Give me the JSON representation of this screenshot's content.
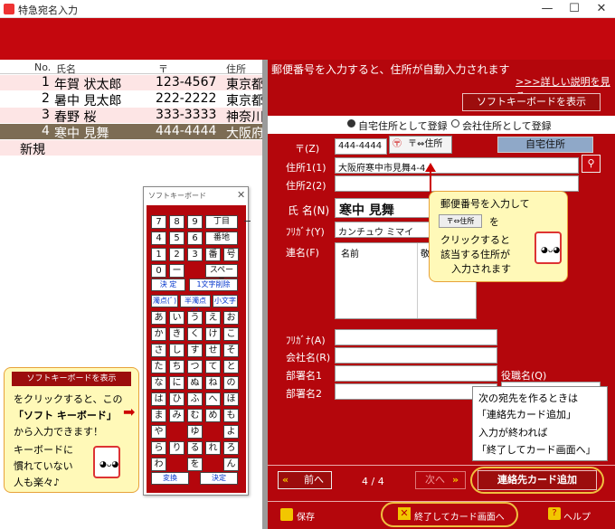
{
  "window": {
    "title": "特急宛名入力",
    "min": "—",
    "max": "☐",
    "close": "✕"
  },
  "table": {
    "headers": [
      "No.",
      "氏名",
      "〒",
      "住所"
    ],
    "rows": [
      {
        "no": "1",
        "name": "年賀 状太郎",
        "zip": "123-4567",
        "addr": "東京都"
      },
      {
        "no": "2",
        "name": "暑中 見太郎",
        "zip": "222-2222",
        "addr": "東京都"
      },
      {
        "no": "3",
        "name": "春野 桜",
        "zip": "333-3333",
        "addr": "神奈川"
      },
      {
        "no": "4",
        "name": "寒中 見舞",
        "zip": "444-4444",
        "addr": "大阪府"
      }
    ],
    "new_row": "新規"
  },
  "form": {
    "heading": "郵便番号を入力すると、住所が自動入力されます",
    "detail_link": ">>>詳しい説明を見る",
    "soft_kbd_btn": "ソフトキーボードを表示",
    "radio_home": "自宅住所として登録",
    "radio_work": "会社住所として登録",
    "zip_label": "〒(Z)",
    "zip_value": "444-4444",
    "zip_conv_btn": "〒⇔住所",
    "home_badge": "自宅住所",
    "addr1_label": "住所1(1)",
    "addr1_value": "大阪府寒中市見舞4-4",
    "addr2_label": "住所2(2)",
    "name_label": "氏 名(N)",
    "name_value": "寒中 見舞",
    "kana_label": "ﾌﾘｶﾞﾅ(Y)",
    "kana_value": "カンチュウ ミマイ",
    "joint_label": "連名(F)",
    "joint_col": "名前",
    "joint_col2": "敬",
    "furigana_label": "ﾌﾘｶﾞﾅ(A)",
    "company_label": "会社名(R)",
    "dept1_label": "部署名1",
    "dept2_label": "部署名2",
    "title_label": "役職名(Q)",
    "prev_btn": "前へ",
    "page": "4 / 4",
    "next_btn": "次へ",
    "add_btn": "連絡先カード追加",
    "save_btn": "保存",
    "finish_btn": "終了してカード画面へ",
    "help_btn": "ヘルプ"
  },
  "callout_zip": {
    "line1": "郵便番号を入力して",
    "line2": "を",
    "btn": "〒⇔住所",
    "line3": "クリックすると",
    "line4": "該当する住所が",
    "line5": "入力されます"
  },
  "callout_next": {
    "l1": "次の宛先を作るときは",
    "l2": "「連絡先カード追加」",
    "l3": "入力が終われば",
    "l4": "「終了してカード画面へ」"
  },
  "callout_kbd": {
    "btn": "ソフトキーボードを表示",
    "l1": "をクリックすると、この",
    "l2": "「ソフト キーボード」",
    "l3": "から入力できます！",
    "l4": "キーボードに",
    "l5": "慣れていない",
    "l6": "人も楽々♪"
  },
  "keyboard": {
    "title": "ソフトキーボード",
    "close": "✕",
    "r1": [
      "7",
      "8",
      "9",
      "丁目"
    ],
    "r2": [
      "4",
      "5",
      "6",
      "番地"
    ],
    "r3": [
      "1",
      "2",
      "3",
      "番",
      "号"
    ],
    "r4": [
      "0",
      "ー",
      "スペース"
    ],
    "r5": [
      "決 定",
      "1文字削除"
    ],
    "r6": [
      "濁点(ﾞ)",
      "半濁点(ﾟ)",
      "小文字"
    ],
    "kana": [
      [
        "あ",
        "い",
        "う",
        "え",
        "お"
      ],
      [
        "か",
        "き",
        "く",
        "け",
        "こ"
      ],
      [
        "さ",
        "し",
        "す",
        "せ",
        "そ"
      ],
      [
        "た",
        "ち",
        "つ",
        "て",
        "と"
      ],
      [
        "な",
        "に",
        "ぬ",
        "ね",
        "の"
      ],
      [
        "は",
        "ひ",
        "ふ",
        "へ",
        "ほ"
      ],
      [
        "ま",
        "み",
        "む",
        "め",
        "も"
      ],
      [
        "や",
        "",
        "ゆ",
        "",
        "よ"
      ],
      [
        "ら",
        "り",
        "る",
        "れ",
        "ろ"
      ],
      [
        "わ",
        "",
        "を",
        "",
        "ん"
      ]
    ],
    "conv": "変換",
    "ok": "決定"
  }
}
